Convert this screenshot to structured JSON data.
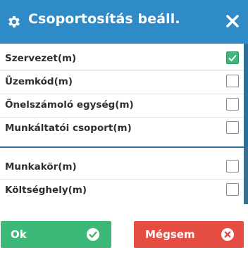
{
  "dialog": {
    "title": "Csoportosítás beáll.",
    "icons": {
      "title": "gear-icon",
      "close": "close-icon"
    }
  },
  "options": [
    {
      "label": "Szervezet(m)",
      "checked": true
    },
    {
      "label": "Üzemkód(m)",
      "checked": false
    },
    {
      "label": "Önelszámoló egység(m)",
      "checked": false
    },
    {
      "label": "Munkáltatói csoport(m)",
      "checked": false
    },
    {
      "label": "Munkakör(m)",
      "checked": false
    },
    {
      "label": "Költséghely(m)",
      "checked": false
    }
  ],
  "buttons": {
    "ok_label": "Ok",
    "ok_icon": "check-circle-icon",
    "cancel_label": "Mégsem",
    "cancel_icon": "times-circle-icon"
  },
  "colors": {
    "header": "#2f8ac8",
    "ok": "#3cb878",
    "cancel": "#e54d42",
    "separator": "#2f6f97"
  }
}
